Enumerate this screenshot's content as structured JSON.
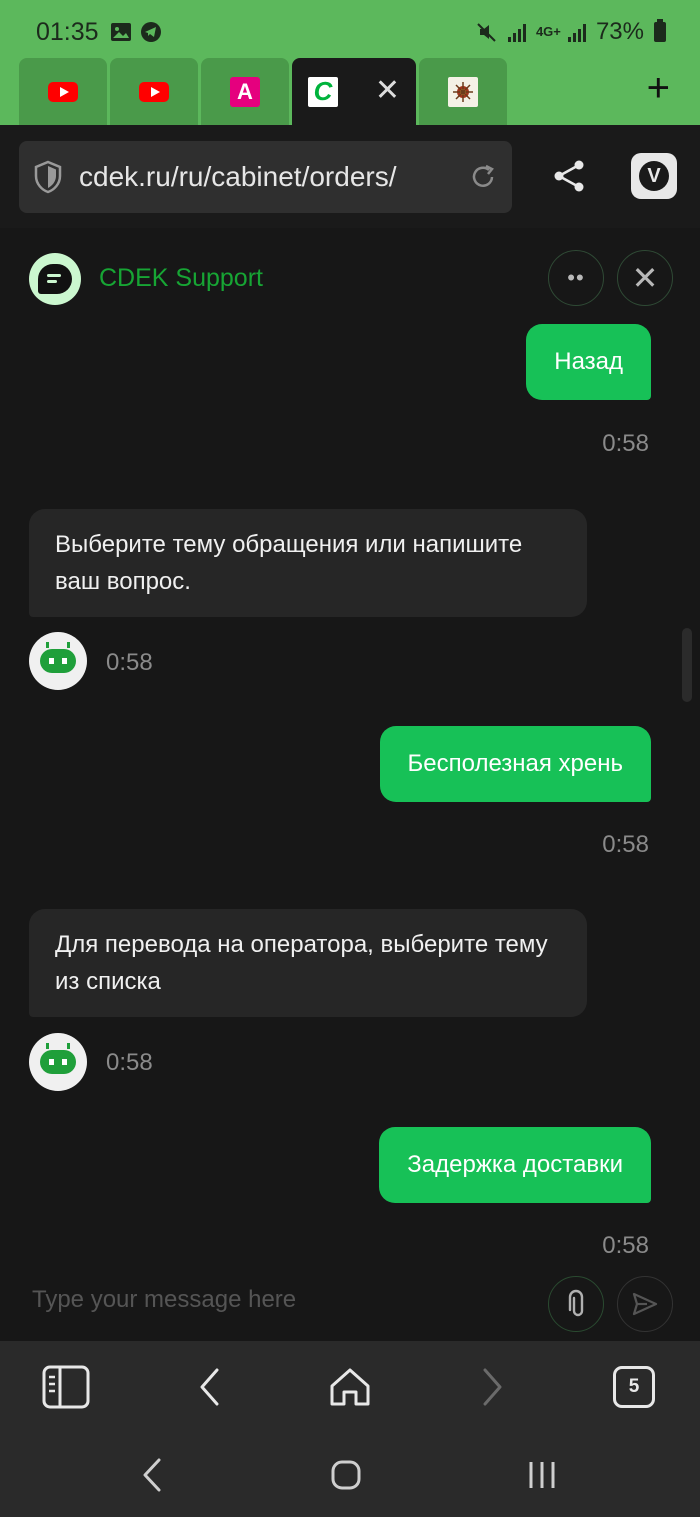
{
  "status_bar": {
    "time": "01:35",
    "network": "4G+",
    "battery": "73%",
    "left_icons": [
      "gallery-icon",
      "telegram-icon"
    ],
    "right_icons": [
      "mute-icon",
      "signal-icon",
      "data-icon",
      "signal-icon",
      "battery-icon"
    ]
  },
  "tabs": [
    {
      "icon": "youtube-icon",
      "active": false
    },
    {
      "icon": "youtube-icon",
      "active": false
    },
    {
      "icon": "alfa-bank-icon",
      "active": false,
      "glyph": "A"
    },
    {
      "icon": "cdek-icon",
      "active": true,
      "glyph": "C",
      "close": "✕"
    },
    {
      "icon": "picture-icon",
      "active": false
    }
  ],
  "new_tab": "+",
  "address_bar": {
    "url": "cdek.ru/ru/cabinet/orders/"
  },
  "chat": {
    "title": "CDEK Support",
    "menu_glyph": "••",
    "close_glyph": "✕",
    "messages": [
      {
        "from": "user",
        "text": "Назад",
        "time": "0:58"
      },
      {
        "from": "bot",
        "text": "Выберите тему обращения или напишите ваш вопрос.",
        "time": "0:58"
      },
      {
        "from": "user",
        "text": "Бесполезная хрень",
        "time": "0:58"
      },
      {
        "from": "bot",
        "text": "Для перевода на оператора, выберите тему из списка",
        "time": "0:58"
      },
      {
        "from": "user",
        "text": "Задержка доставки",
        "time": "0:58"
      }
    ],
    "input_placeholder": "Type your message here"
  },
  "bottom_bar": {
    "tab_count": "5"
  },
  "colors": {
    "accent_green": "#17c157",
    "title_green": "#17a534",
    "top_bar": "#5cb85c"
  }
}
